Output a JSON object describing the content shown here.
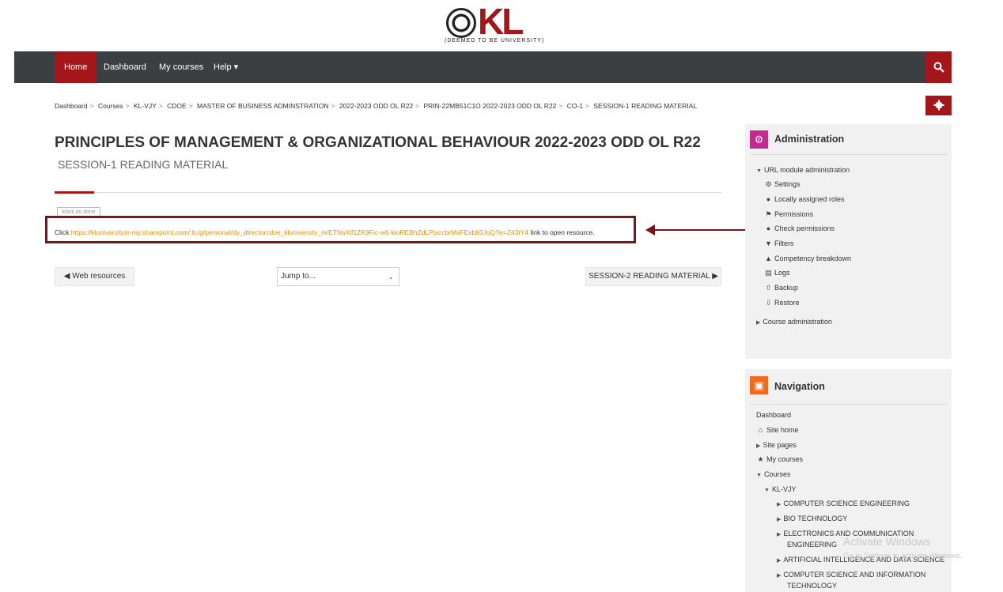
{
  "logo": {
    "text": "KL",
    "subtext": "(DEEMED TO BE UNIVERSITY)"
  },
  "navbar": {
    "items": [
      {
        "label": "Home"
      },
      {
        "label": "Dashboard"
      },
      {
        "label": "My courses"
      },
      {
        "label": "Help ▾"
      }
    ],
    "search_icon": "search-icon"
  },
  "breadcrumb": [
    "Dashboard",
    "Courses",
    "KL-VJY",
    "CDOE",
    "MASTER OF BUSINESS ADMINSTRATION",
    "2022-2023 ODD OL R22",
    "PRIN-22MB51C1O 2022-2023 ODD OL R22",
    "CO-1",
    "SESSION-1 READING MATERIAL"
  ],
  "page": {
    "title": "PRINCIPLES OF MANAGEMENT & ORGANIZATIONAL BEHAVIOUR 2022-2023 ODD OL R22",
    "subtitle": "SESSION-1 READING MATERIAL",
    "mark_done": "Mark as done",
    "resource_prefix": "Click",
    "resource_link": "https://kluniversityin-my.sharepoint.com/:b:/g/personal/dy_directorcdoe_kluniversity_in/ETNsXlf1ZK9Fic-w6-kioREBhZdLPjsccbrMxFExb93JoQ?e=Z43tY4",
    "resource_suffix": "link to open resource.",
    "prev_label": "◀ Web resources",
    "jump_placeholder": "Jump to...",
    "next_label": "SESSION-2 READING MATERIAL ▶"
  },
  "administration": {
    "title": "Administration",
    "url_module": "URL module administration",
    "items": [
      {
        "label": "Settings",
        "icon": "gear-icon"
      },
      {
        "label": "Locally assigned roles",
        "icon": "user-icon"
      },
      {
        "label": "Permissions",
        "icon": "key-icon"
      },
      {
        "label": "Check permissions",
        "icon": "user-check-icon"
      },
      {
        "label": "Filters",
        "icon": "filter-icon"
      },
      {
        "label": "Competency breakdown",
        "icon": "competency-icon"
      },
      {
        "label": "Logs",
        "icon": "logs-icon"
      },
      {
        "label": "Backup",
        "icon": "backup-icon"
      },
      {
        "label": "Restore",
        "icon": "restore-icon"
      }
    ],
    "course_admin": "Course administration"
  },
  "navigation": {
    "title": "Navigation",
    "dashboard": "Dashboard",
    "site_home": "Site home",
    "site_pages": "Site pages",
    "my_courses": "My courses",
    "courses": "Courses",
    "kl_vjy": "KL-VJY",
    "departments": [
      "COMPUTER SCIENCE ENGINEERING",
      "BIO TECHNOLOGY",
      "ELECTRONICS AND COMMUNICATION",
      "ENGINEERING",
      "ARTIFICIAL INTELLIGENCE AND DATA SCIENCE",
      "COMPUTER SCIENCE AND INFORMATION",
      "TECHNOLOGY"
    ]
  },
  "watermark": {
    "line1": "Activate Windows",
    "line2": "Go to Settings to activate Windows."
  }
}
